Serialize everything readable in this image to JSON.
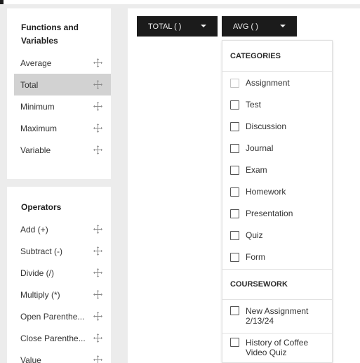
{
  "functions_panel": {
    "title": "Functions and Variables",
    "items": [
      {
        "label": "Average",
        "icon": "move-icon",
        "selected": false
      },
      {
        "label": "Total",
        "icon": "move-icon",
        "selected": true
      },
      {
        "label": "Minimum",
        "icon": "move-icon",
        "selected": false
      },
      {
        "label": "Maximum",
        "icon": "move-icon",
        "selected": false
      },
      {
        "label": "Variable",
        "icon": "move-icon",
        "selected": false
      }
    ]
  },
  "operators_panel": {
    "title": "Operators",
    "items": [
      {
        "label": "Add (+)",
        "icon": "move-icon"
      },
      {
        "label": "Subtract (-)",
        "icon": "move-icon"
      },
      {
        "label": "Divide (/)",
        "icon": "move-icon"
      },
      {
        "label": "Multiply (*)",
        "icon": "move-icon"
      },
      {
        "label": "Open Parenthe...",
        "icon": "move-icon"
      },
      {
        "label": "Close Parenthe...",
        "icon": "move-icon"
      },
      {
        "label": "Value",
        "icon": "move-icon"
      }
    ]
  },
  "formula": {
    "total_button": "TOTAL ( )",
    "avg_button": "AVG ( )"
  },
  "avg_dropdown": {
    "categories_heading": "CATEGORIES",
    "categories": [
      {
        "label": "Assignment",
        "disabled": true
      },
      {
        "label": "Test",
        "disabled": false
      },
      {
        "label": "Discussion",
        "disabled": false
      },
      {
        "label": "Journal",
        "disabled": false
      },
      {
        "label": "Exam",
        "disabled": false
      },
      {
        "label": "Homework",
        "disabled": false
      },
      {
        "label": "Presentation",
        "disabled": false
      },
      {
        "label": "Quiz",
        "disabled": false
      },
      {
        "label": "Form",
        "disabled": false
      }
    ],
    "coursework_heading": "COURSEWORK",
    "coursework": [
      {
        "label": "New Assignment 2/13/24"
      },
      {
        "label": "History of Coffee Video Quiz"
      }
    ]
  },
  "colors": {
    "background": "#ececec",
    "button_dark": "#1b1b1b",
    "selected_row": "#d2d2d2"
  }
}
